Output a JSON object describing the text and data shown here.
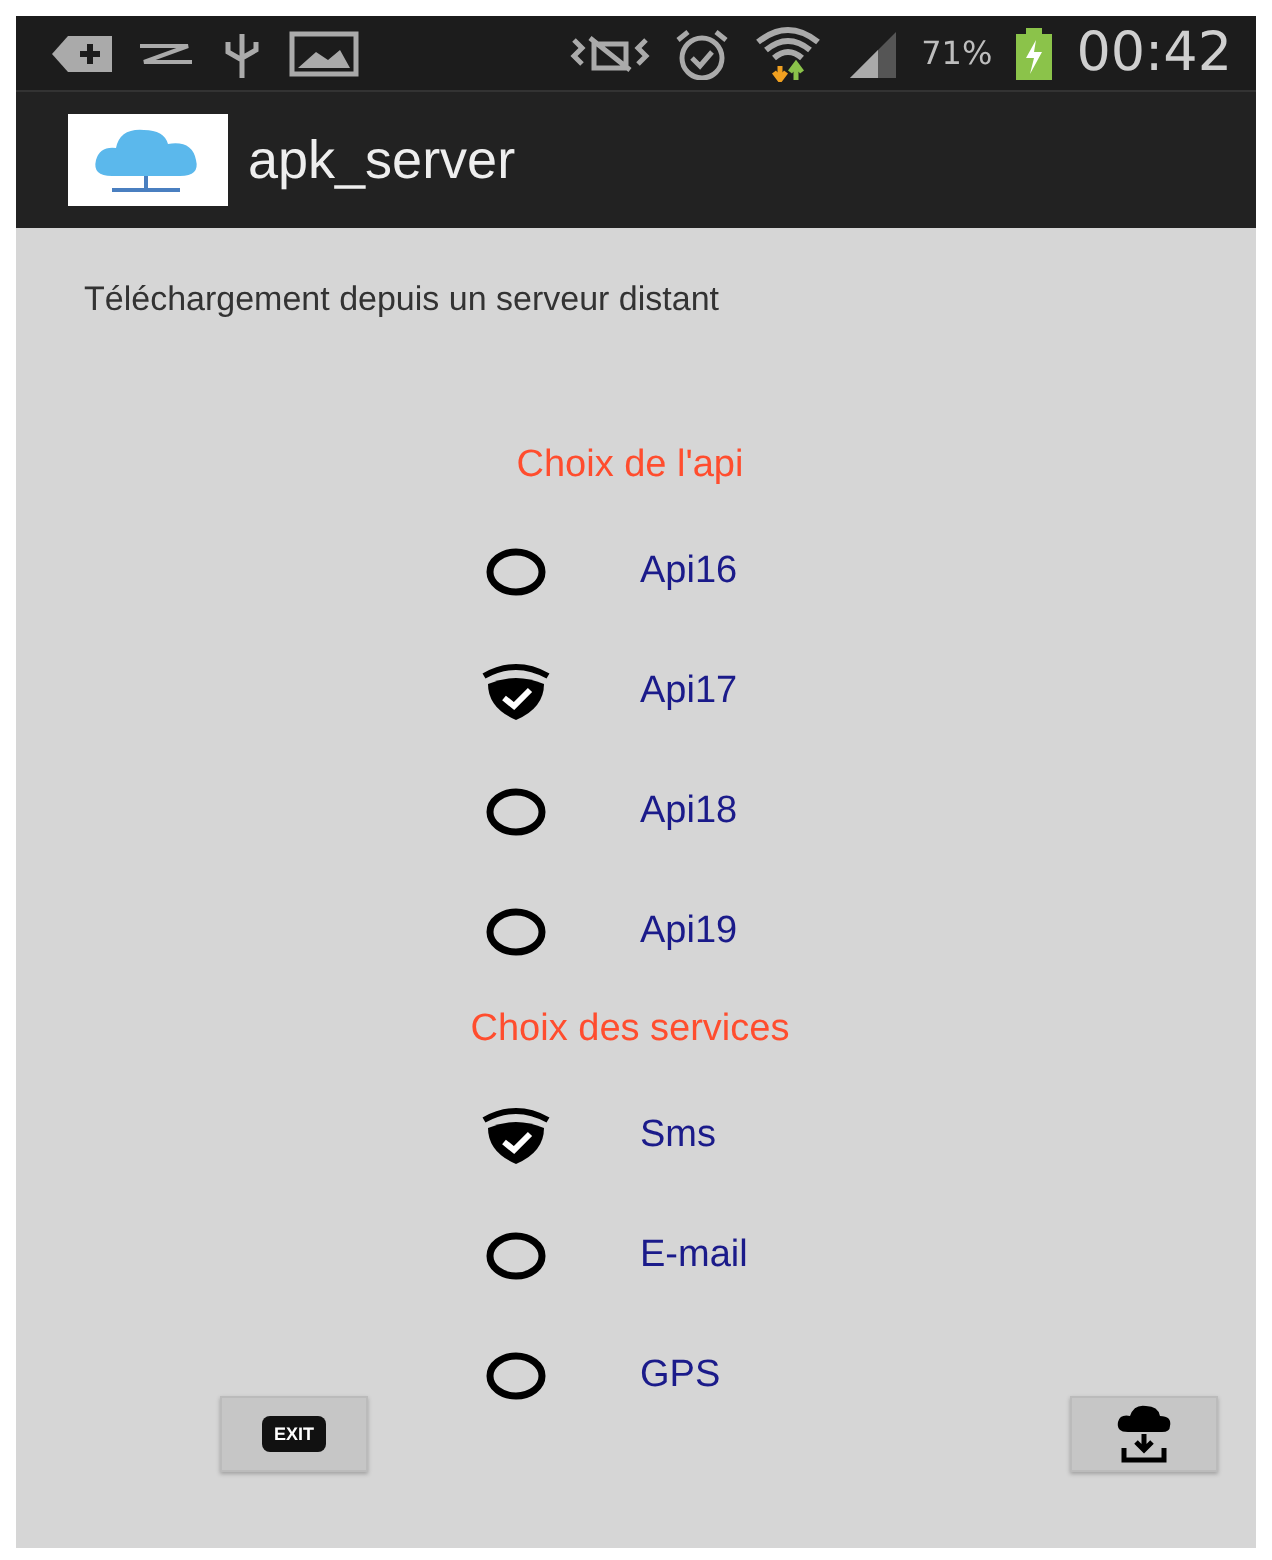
{
  "status_bar": {
    "battery": "71%",
    "time": "00:42"
  },
  "action_bar": {
    "title": "apk_server"
  },
  "subtitle": "Téléchargement depuis un serveur distant",
  "api_section": {
    "heading": "Choix de l'api",
    "options": [
      {
        "label": "Api16",
        "selected": false
      },
      {
        "label": "Api17",
        "selected": true
      },
      {
        "label": "Api18",
        "selected": false
      },
      {
        "label": "Api19",
        "selected": false
      }
    ]
  },
  "services_section": {
    "heading": "Choix des services",
    "options": [
      {
        "label": "Sms",
        "checked": true
      },
      {
        "label": "E-mail",
        "checked": false
      },
      {
        "label": "GPS",
        "checked": false
      }
    ]
  },
  "footer": {
    "exit_label": "EXIT"
  }
}
